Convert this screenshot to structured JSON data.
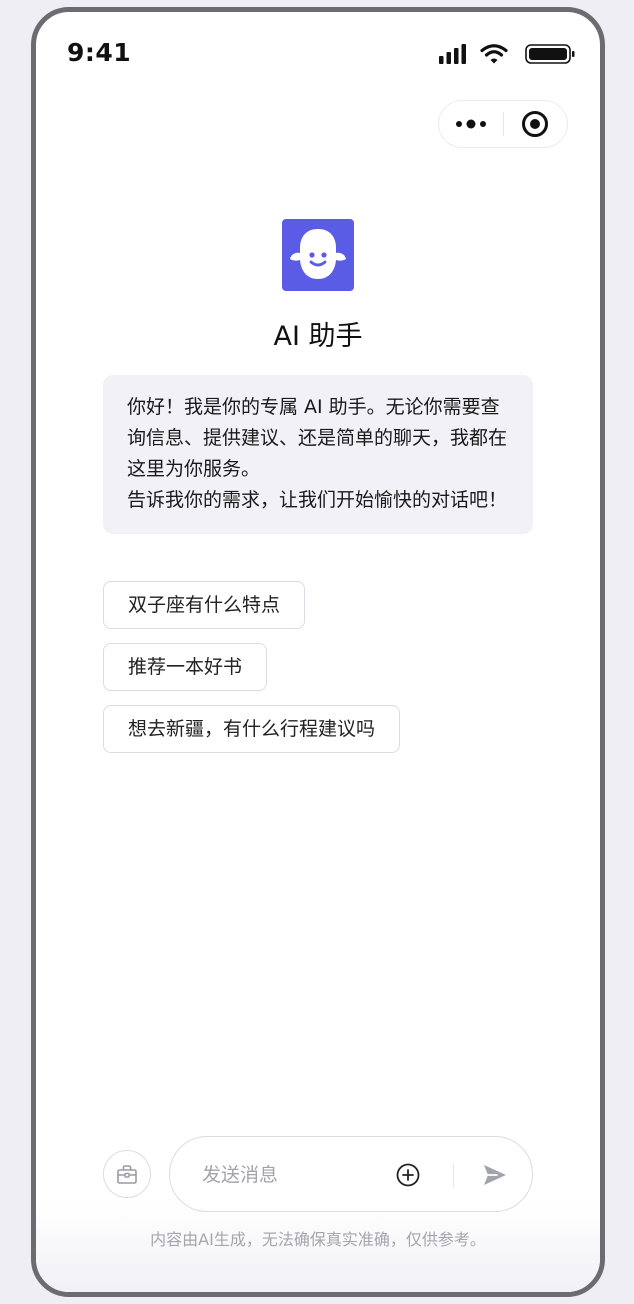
{
  "status_bar": {
    "time": "9:41"
  },
  "assistant": {
    "name": "AI 助手"
  },
  "greeting": {
    "line1": "你好！我是你的专属 AI 助手。无论你需要查询信息、提供建议、还是简单的聊天，我都在这里为你服务。",
    "line2": "告诉我你的需求，让我们开始愉快的对话吧！"
  },
  "suggestions": [
    {
      "label": "双子座有什么特点"
    },
    {
      "label": "推荐一本好书"
    },
    {
      "label": "想去新疆，有什么行程建议吗"
    }
  ],
  "input": {
    "placeholder": "发送消息"
  },
  "footer": {
    "disclaimer": "内容由AI生成，无法确保真实准确，仅供参考。"
  },
  "colors": {
    "accent": "#5b5ce6",
    "bubble_bg": "#f1f1f7",
    "border": "#dcdce2"
  },
  "icons": {
    "capsule_more": "more-dots-icon",
    "capsule_close": "target-circle-icon",
    "tool": "toolbox-icon",
    "add": "plus-circle-icon",
    "send": "send-arrow-icon"
  }
}
